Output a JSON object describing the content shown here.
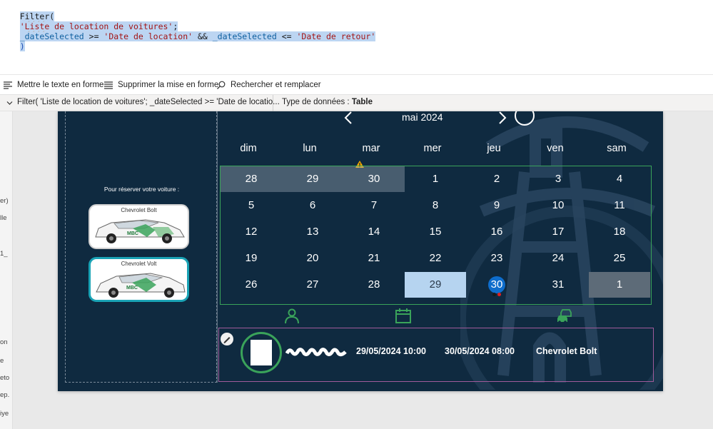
{
  "editor": {
    "line1": "Filter(",
    "line2_dots": "····",
    "line2_str": "'Liste de location de voitures'",
    "line2_end": ";",
    "line3_dots": "····",
    "line3_var1": "_dateSelected",
    "line3_op1": " >= ",
    "line3_str1": "'Date de location'",
    "line3_and": " && ",
    "line3_var2": "_dateSelected",
    "line3_op2": " <= ",
    "line3_str2": "'Date de retour'",
    "line4": ")"
  },
  "toolbar": {
    "format_label": "Mettre le texte en forme",
    "unformat_label": "Supprimer la mise en forme",
    "find_label": "Rechercher et remplacer"
  },
  "summary": {
    "formula": "Filter( 'Liste de location de voitures'; _dateSelected >= 'Date de locatio...",
    "type_label": "Type de données : ",
    "type_value": "Table"
  },
  "left_panel_fragments": [
    "er)",
    "lle",
    "1_",
    "on",
    "e",
    "eto",
    "ep.",
    "iye"
  ],
  "app": {
    "reserve_label": "Pour réserver votre voiture :",
    "cars": [
      {
        "name": "Chevrolet Bolt",
        "logo_text": "MBC"
      },
      {
        "name": "Chevrolet Volt",
        "logo_text": "MBC"
      }
    ],
    "calendar": {
      "month_label": "mai 2024",
      "prev_icon": "chevron-left-icon",
      "next_icon": "chevron-right-icon",
      "weekdays": [
        "dim",
        "lun",
        "mar",
        "mer",
        "jeu",
        "ven",
        "sam"
      ],
      "weeks": [
        [
          "28",
          "29",
          "30",
          "1",
          "2",
          "3",
          "4"
        ],
        [
          "5",
          "6",
          "7",
          "8",
          "9",
          "10",
          "11"
        ],
        [
          "12",
          "13",
          "14",
          "15",
          "16",
          "17",
          "18"
        ],
        [
          "19",
          "20",
          "21",
          "22",
          "23",
          "24",
          "25"
        ],
        [
          "26",
          "27",
          "28",
          "29",
          "30",
          "31",
          "1"
        ]
      ],
      "outside_month_first_row": [
        0,
        1,
        2
      ],
      "selected_day": "29",
      "today_day": "30",
      "trailing_grey_day": "1",
      "event_dot_colors": [
        "#1a1a1a",
        "#e02020"
      ]
    },
    "tabs": [
      {
        "icon": "person-icon"
      },
      {
        "icon": "calendar-icon"
      },
      {
        "icon": "cars-icon"
      }
    ],
    "reservation": {
      "start": "29/05/2024 10:00",
      "end": "30/05/2024 08:00",
      "car": "Chevrolet Bolt"
    },
    "colors": {
      "background": "#0f2a40",
      "accent_green": "#3aa35a",
      "selected": "#b6d4f0",
      "today": "#0e6dcc"
    }
  }
}
